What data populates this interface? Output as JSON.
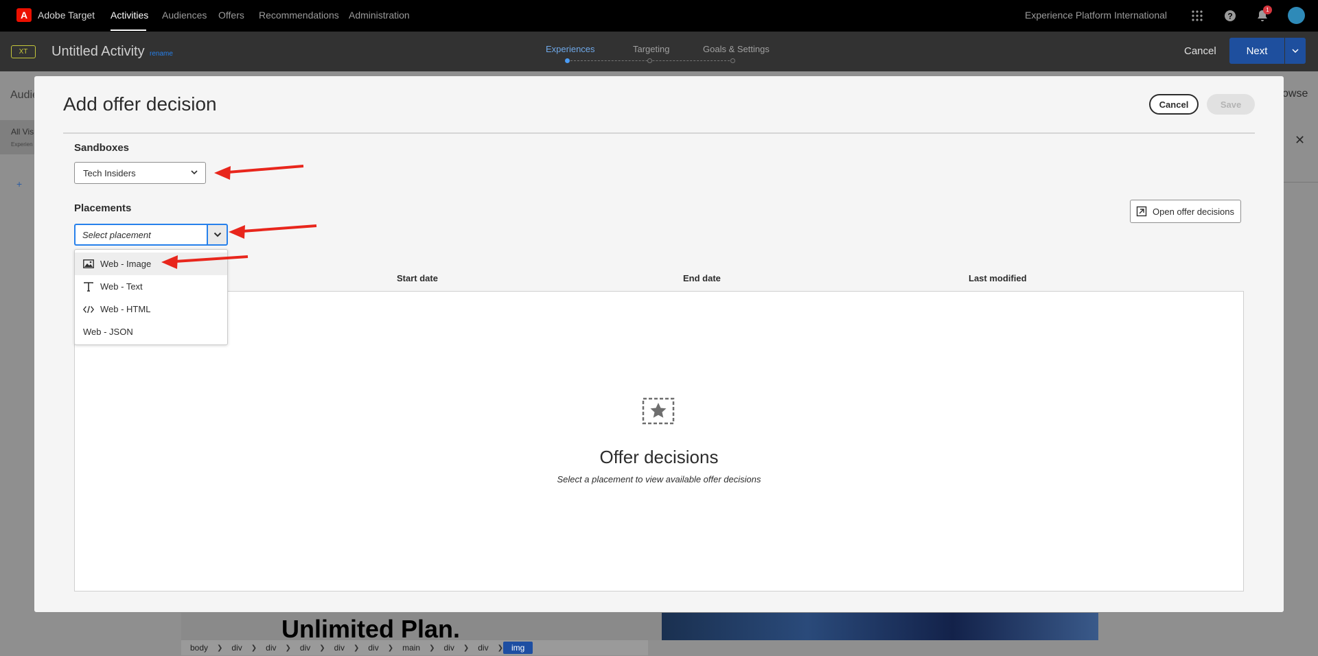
{
  "topnav": {
    "app_name": "Adobe Target",
    "items": [
      {
        "label": "Activities",
        "active": true
      },
      {
        "label": "Audiences",
        "active": false
      },
      {
        "label": "Offers",
        "active": false
      },
      {
        "label": "Recommendations",
        "active": false
      },
      {
        "label": "Administration",
        "active": false
      }
    ],
    "org_name": "Experience Platform International",
    "notification_count": "1",
    "icons": [
      "apps-grid-icon",
      "help-icon",
      "bell-icon",
      "avatar"
    ]
  },
  "activity_header": {
    "type_badge": "XT",
    "title": "Untitled Activity",
    "rename_link": "rename",
    "steps": [
      {
        "label": "Experiences",
        "active": true
      },
      {
        "label": "Targeting",
        "active": false
      },
      {
        "label": "Goals & Settings",
        "active": false
      }
    ],
    "cancel_label": "Cancel",
    "next_label": "Next"
  },
  "background": {
    "left_label": "Audie",
    "left_panel_title": "All Visi",
    "left_panel_sub": "Experien",
    "right_label": "owse",
    "site_headline": "Unlimited Plan.",
    "breadcrumbs": [
      "body",
      "div",
      "div",
      "div",
      "div",
      "div",
      "main",
      "div",
      "div",
      "img"
    ]
  },
  "modal": {
    "title": "Add offer decision",
    "cancel_label": "Cancel",
    "save_label": "Save",
    "sandboxes_label": "Sandboxes",
    "sandbox_value": "Tech Insiders",
    "placements_label": "Placements",
    "placement_placeholder": "Select placement",
    "open_decisions_label": "Open offer decisions",
    "table_columns": [
      "Start date",
      "End date",
      "Last modified"
    ],
    "empty_title": "Offer decisions",
    "empty_subtitle": "Select a placement to view available offer decisions",
    "placement_options": [
      {
        "label": "Web - Image",
        "icon": "image-icon",
        "highlighted": true
      },
      {
        "label": "Web - Text",
        "icon": "text-icon",
        "highlighted": false
      },
      {
        "label": "Web - HTML",
        "icon": "code-icon",
        "highlighted": false
      },
      {
        "label": "Web - JSON",
        "icon": "",
        "highlighted": false
      }
    ]
  },
  "colors": {
    "accent_blue": "#2680eb",
    "next_button": "#1e4f9e",
    "annotation_arrow": "#e8261c",
    "adobe_red": "#eb1000"
  }
}
